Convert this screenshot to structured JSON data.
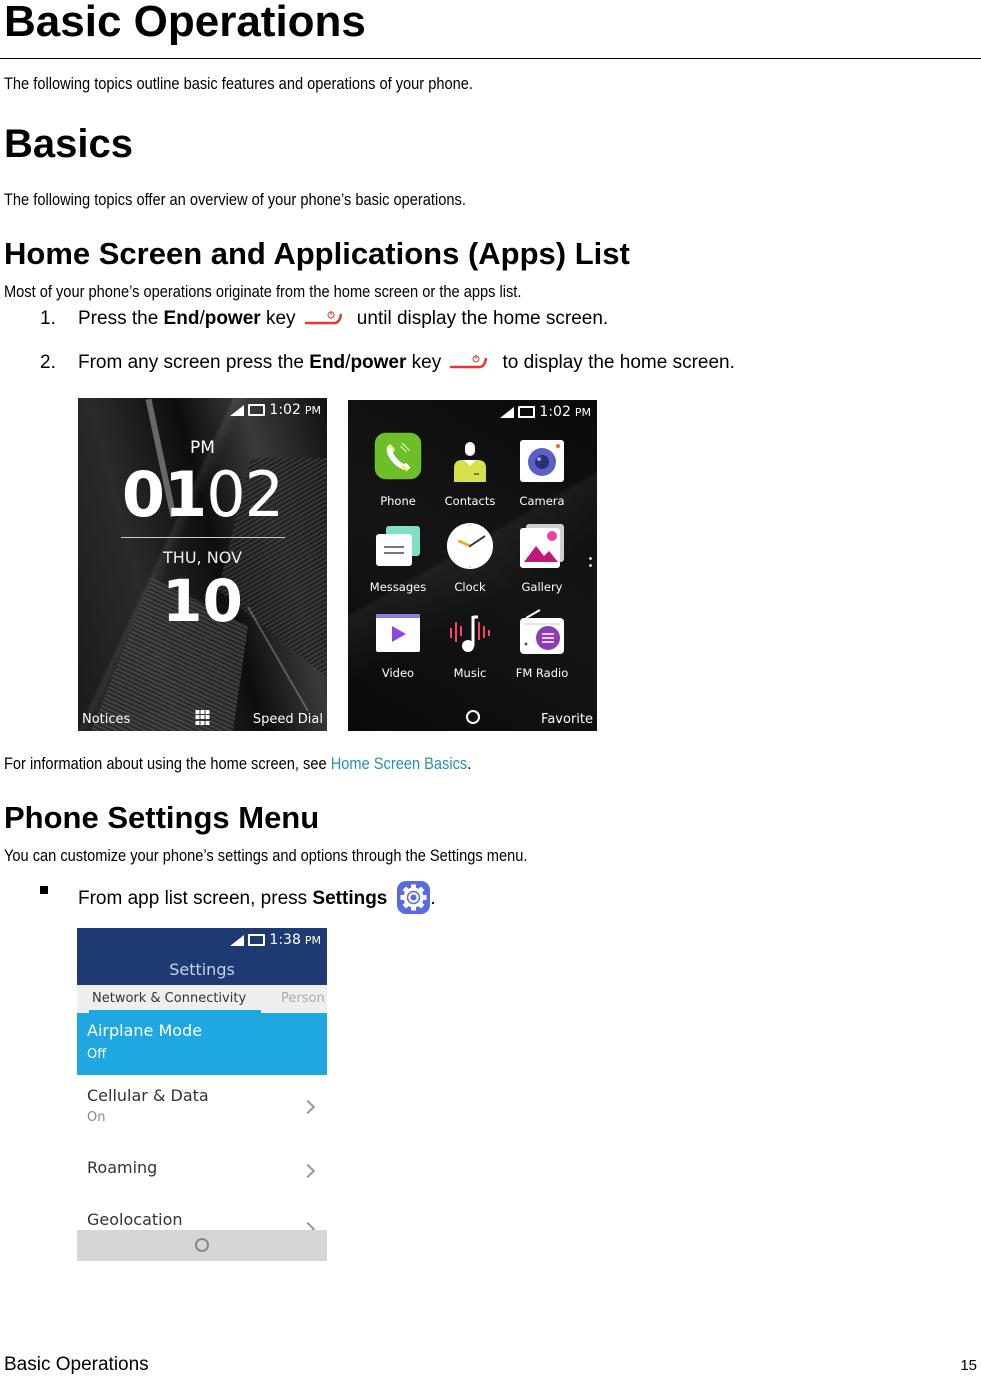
{
  "page": {
    "title": "Basic Operations",
    "intro": "The following topics outline basic features and operations of your phone.",
    "section_basics": {
      "heading": "Basics",
      "intro": "The following topics offer an overview of your phone’s basic operations."
    },
    "section_home": {
      "heading": "Home Screen and Applications (Apps) List",
      "intro": "Most of your phone’s operations originate from the home screen or the apps list.",
      "steps": [
        {
          "number": "1.",
          "pre": "Press the ",
          "bold1": "End",
          "slash": "/",
          "bold2": "power",
          "mid": " key",
          "post": " until display the home screen.",
          "icon": "end-power-key-icon"
        },
        {
          "number": "2.",
          "pre": "From any screen press the ",
          "bold1": "End",
          "slash": "/",
          "bold2": "power",
          "mid": " key",
          "post": " to display the home screen.",
          "icon": "end-power-key-icon"
        }
      ],
      "info_pre": "For information about using the home screen, see ",
      "info_link": "Home Screen Basics",
      "info_post": "."
    },
    "section_settings": {
      "heading": "Phone Settings Menu",
      "intro": "You can customize your phone’s settings and options through the Settings menu.",
      "bullet_pre": "From app list screen, press ",
      "bullet_bold": "Settings",
      "bullet_post": ".",
      "bullet_icon": "settings-gear-icon"
    },
    "footer": {
      "left": "Basic Operations",
      "page_number": "15"
    }
  },
  "screens": {
    "home": {
      "status_time": "1:02",
      "status_ampm": "PM",
      "clock_ampm": "PM",
      "clock_hour": "01",
      "clock_minute": "02",
      "date_line": "THU, NOV",
      "day": "10",
      "softkey_left": "Notices",
      "softkey_center_icon": "apps-grid-icon",
      "softkey_right": "Speed Dial"
    },
    "apps": {
      "status_time": "1:02",
      "status_ampm": "PM",
      "items": [
        {
          "label": "Phone",
          "icon": "phone-icon",
          "color": "#6cbf2a"
        },
        {
          "label": "Contacts",
          "icon": "contacts-icon",
          "color": "#d8e04a"
        },
        {
          "label": "Camera",
          "icon": "camera-icon",
          "color": "#5a5fc9"
        },
        {
          "label": "Messages",
          "icon": "messages-icon",
          "color": "#7fe0c5"
        },
        {
          "label": "Clock",
          "icon": "clock-icon",
          "color": "#f5a623"
        },
        {
          "label": "Gallery",
          "icon": "gallery-icon",
          "color": "#c2187a"
        },
        {
          "label": "Video",
          "icon": "video-icon",
          "color": "#8e44e8"
        },
        {
          "label": "Music",
          "icon": "music-icon",
          "color": "#f2466b"
        },
        {
          "label": "FM Radio",
          "icon": "fm-radio-icon",
          "color": "#8e3bb5"
        }
      ],
      "softkey_center_icon": "home-circle-icon",
      "softkey_right": "Favorite"
    },
    "settings": {
      "status_time": "1:38",
      "status_ampm": "PM",
      "title": "Settings",
      "tabs": [
        "Network & Connectivity",
        "Person"
      ],
      "rows": [
        {
          "title": "Airplane Mode",
          "subtitle": "Off",
          "selected": true
        },
        {
          "title": "Cellular & Data",
          "subtitle": "On"
        },
        {
          "title": "Roaming",
          "subtitle": ""
        },
        {
          "title": "Geolocation",
          "subtitle": ""
        }
      ],
      "header_color": "#1f3a73",
      "accent_color": "#1ea7e1"
    }
  },
  "colors": {
    "link": "#2a8bb8",
    "power_key": "#e03a2f",
    "settings_icon": "#5a6be0"
  }
}
